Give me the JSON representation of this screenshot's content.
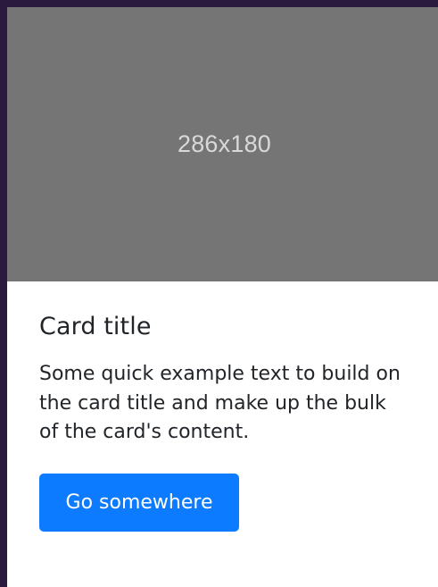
{
  "card": {
    "image_placeholder": "286x180",
    "title": "Card title",
    "text": "Some quick example text to build on the card title and make up the bulk of the card's content.",
    "button_label": "Go somewhere"
  },
  "colors": {
    "background": "#2a1a3d",
    "image_bg": "#757575",
    "button_bg": "#0d7bff",
    "card_bg": "#ffffff",
    "text": "#212529"
  }
}
